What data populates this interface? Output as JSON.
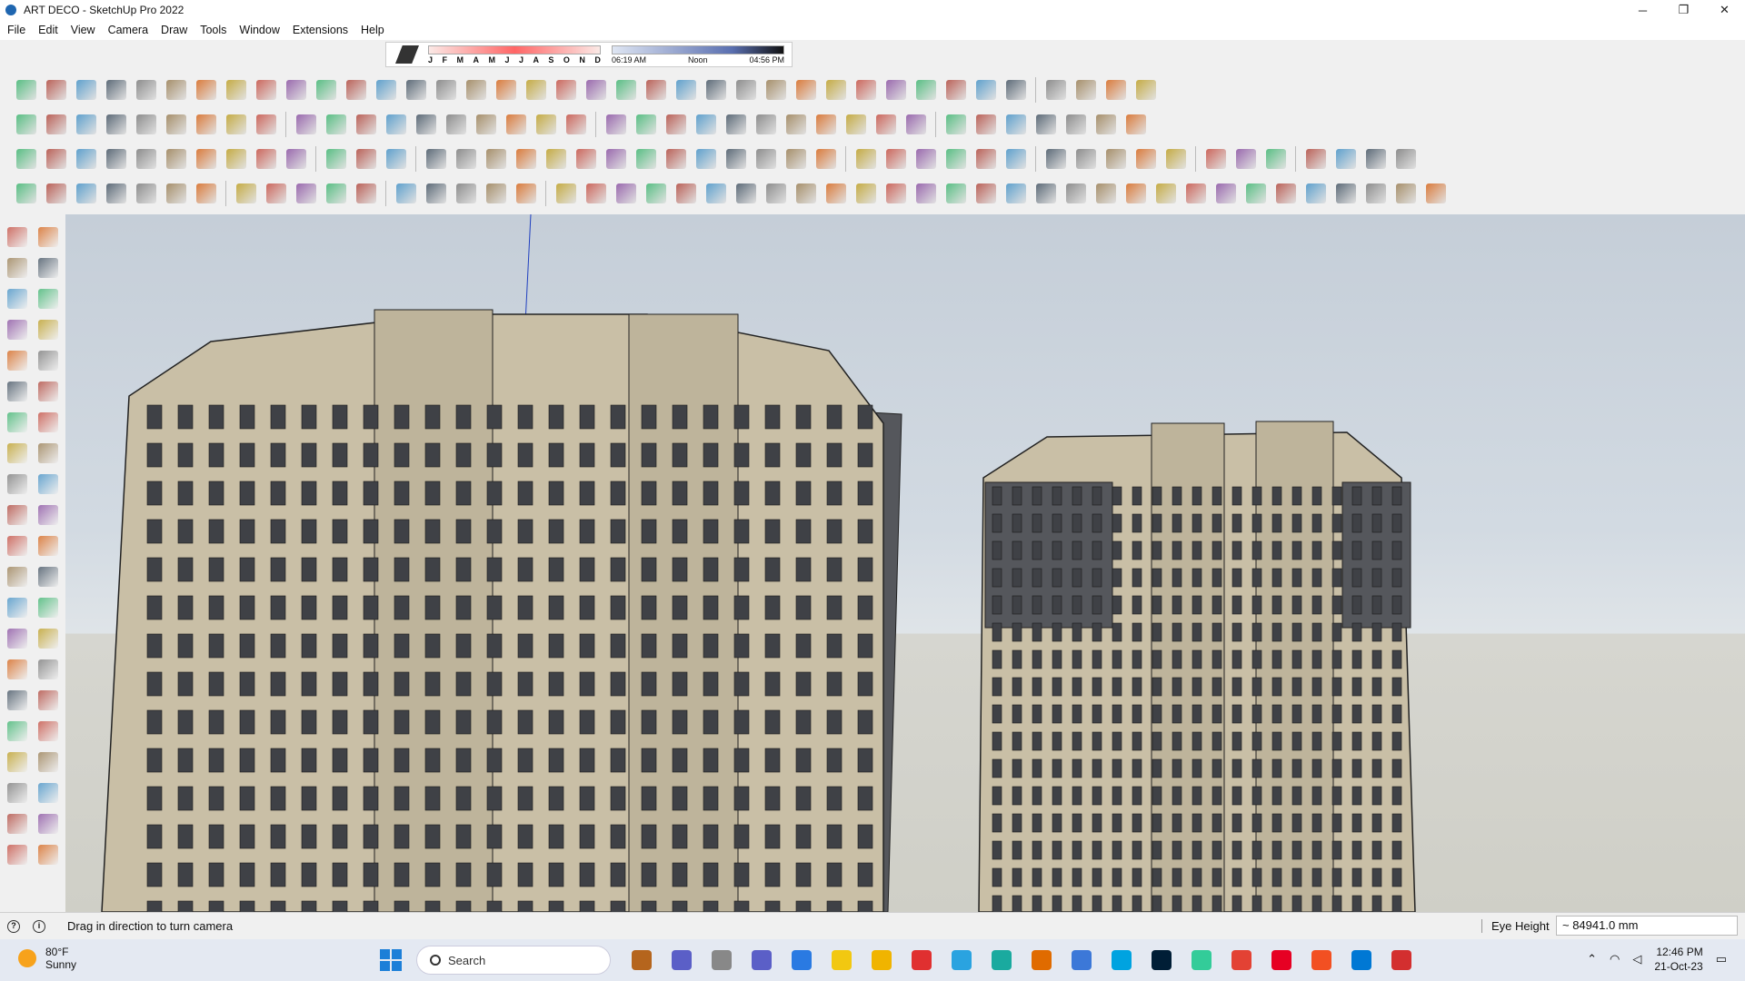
{
  "window": {
    "title": "ART DECO - SketchUp Pro 2022",
    "minimize": "─",
    "restore": "❐",
    "close": "✕"
  },
  "menu": [
    "File",
    "Edit",
    "View",
    "Camera",
    "Draw",
    "Tools",
    "Window",
    "Extensions",
    "Help"
  ],
  "shadows": {
    "months": [
      "J",
      "F",
      "M",
      "A",
      "M",
      "J",
      "J",
      "A",
      "S",
      "O",
      "N",
      "D"
    ],
    "sunrise": "06:19 AM",
    "noon": "Noon",
    "sunset": "04:56 PM"
  },
  "status": {
    "hint": "Drag in direction to turn camera",
    "measure_label": "Eye Height",
    "measure_value": "~ 84941.0 mm"
  },
  "taskbar": {
    "temp": "80°F",
    "condition": "Sunny",
    "search_placeholder": "Search",
    "time": "12:46 PM",
    "date": "21-Oct-23"
  },
  "colors": {
    "accent": "#1c7fd8",
    "facade": "#c9bfa6",
    "dark_panel": "#55575c",
    "sky": "#c8d0d9"
  },
  "toolbars": {
    "row_icons": "sketchup-tool-icons"
  }
}
